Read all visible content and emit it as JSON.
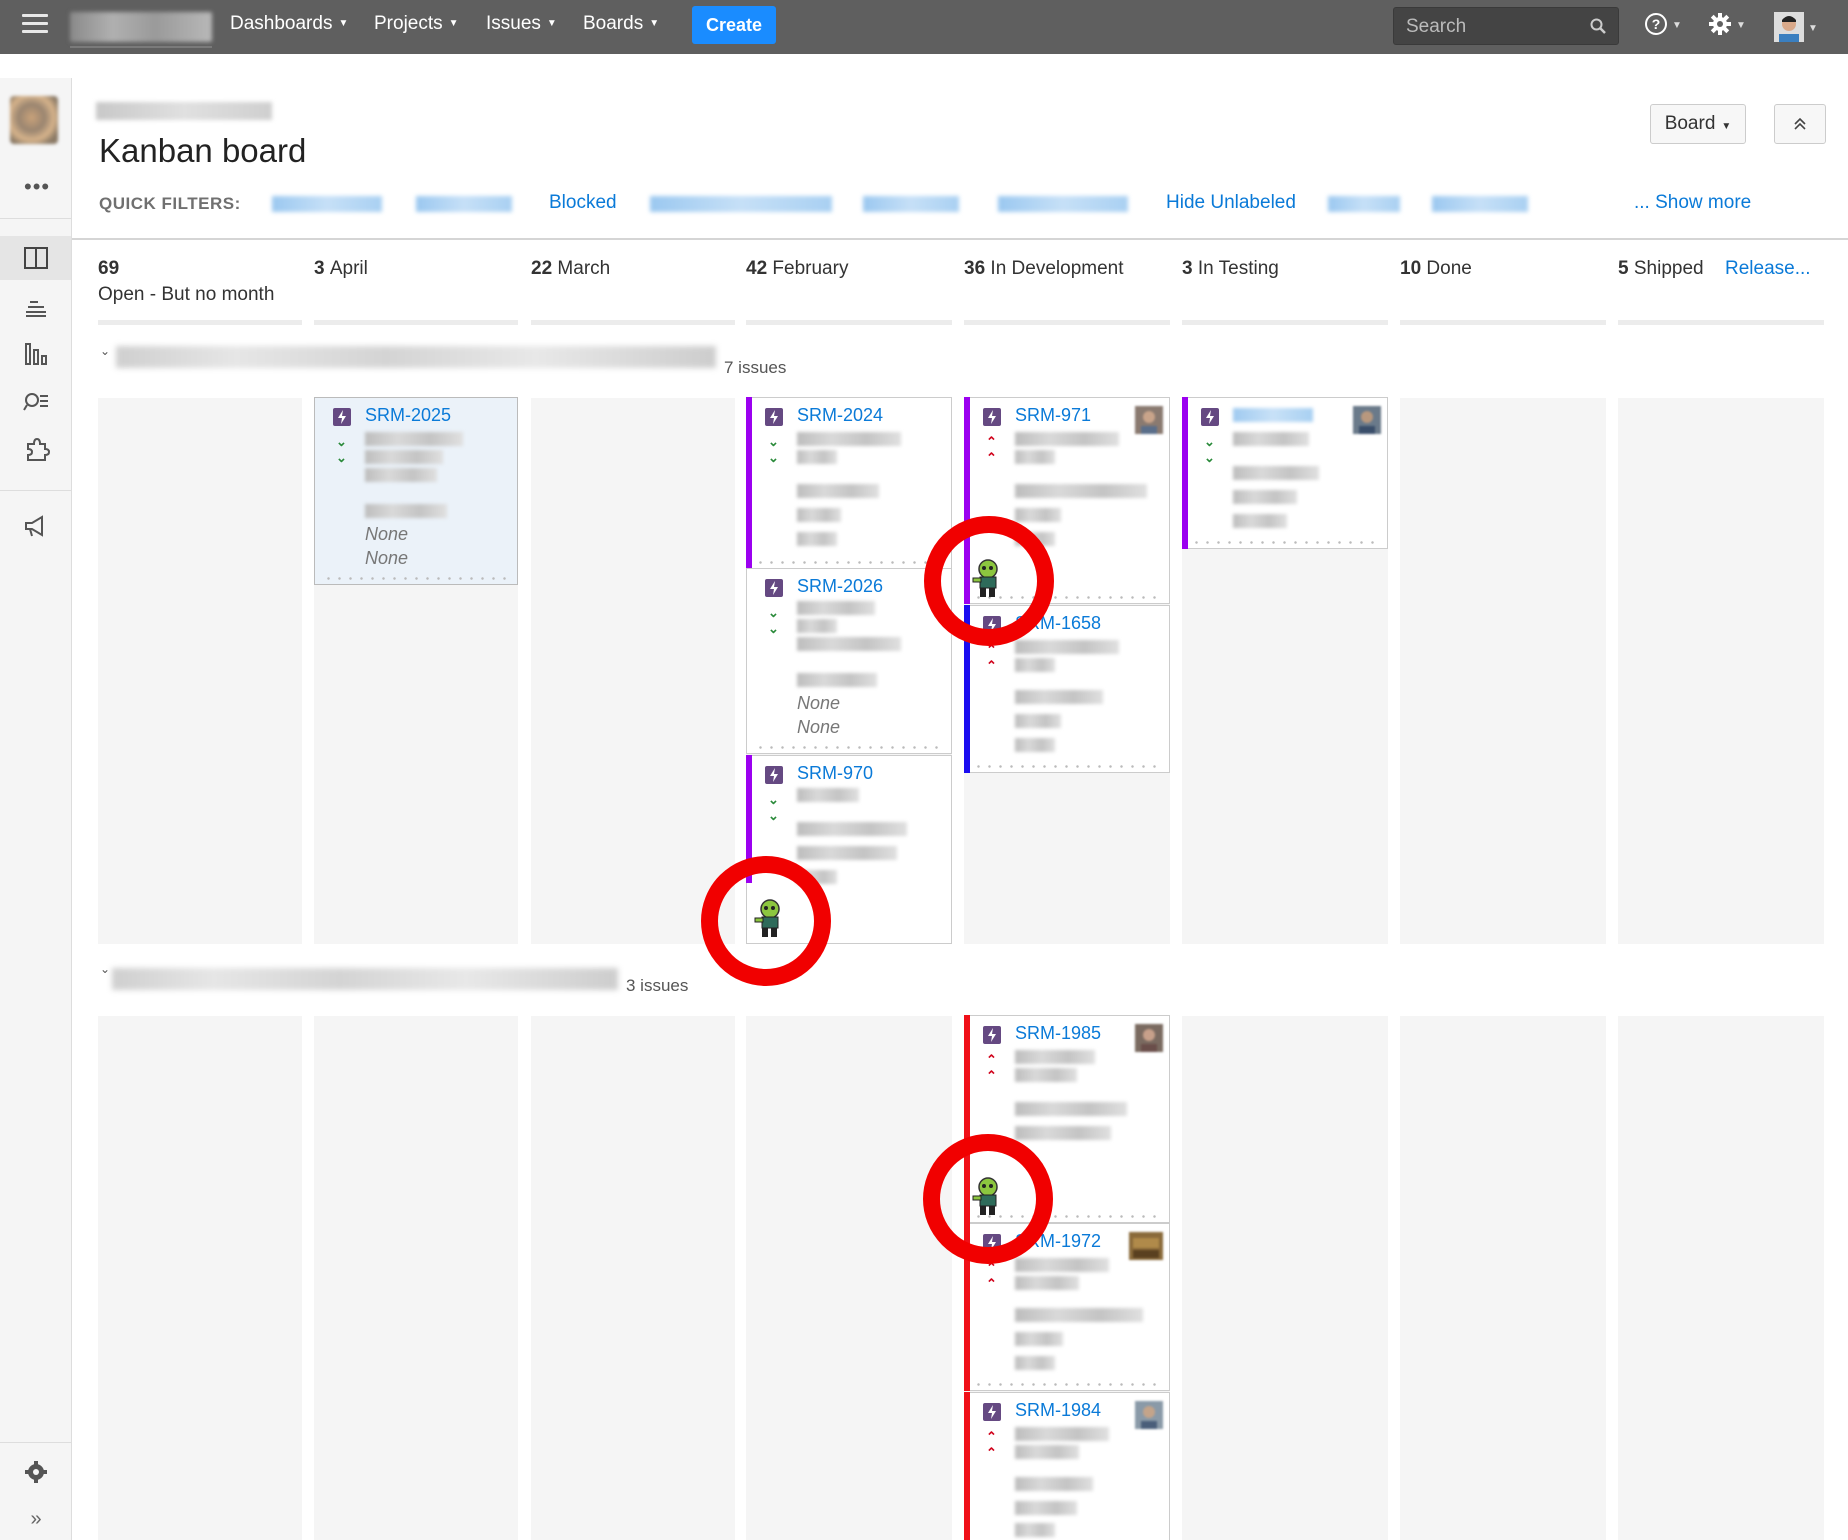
{
  "nav": {
    "menu_items": [
      "Dashboards",
      "Projects",
      "Issues",
      "Boards"
    ],
    "create_label": "Create",
    "search_placeholder": "Search"
  },
  "header": {
    "title": "Kanban board",
    "board_button": "Board"
  },
  "quick_filters": {
    "label": "QUICK FILTERS:",
    "visible_items": [
      "Blocked",
      "Hide Unlabeled"
    ],
    "show_more": "... Show more"
  },
  "columns": [
    {
      "count": "69",
      "name": "Open - But no month"
    },
    {
      "count": "3",
      "name": "April"
    },
    {
      "count": "22",
      "name": "March"
    },
    {
      "count": "42",
      "name": "February"
    },
    {
      "count": "36",
      "name": "In Development"
    },
    {
      "count": "3",
      "name": "In Testing"
    },
    {
      "count": "10",
      "name": "Done"
    },
    {
      "count": "5",
      "name": "Shipped"
    }
  ],
  "release_link": "Release...",
  "swimlanes": [
    {
      "count_label": "7 issues"
    },
    {
      "count_label": "3 issues"
    }
  ],
  "cards": [
    {
      "key": "SRM-2025",
      "priority": "low",
      "none1": "None",
      "none2": "None"
    },
    {
      "key": "SRM-2024",
      "priority": "low"
    },
    {
      "key": "SRM-2026",
      "priority": "low",
      "none1": "None",
      "none2": "None"
    },
    {
      "key": "SRM-970",
      "priority": "low"
    },
    {
      "key": "SRM-971",
      "priority": "high"
    },
    {
      "key": "SRM-1658",
      "priority": "high"
    },
    {
      "key": "",
      "priority": "low"
    },
    {
      "key": "SRM-1985",
      "priority": "high"
    },
    {
      "key": "SRM-1972",
      "priority": "high"
    },
    {
      "key": "SRM-1984",
      "priority": "high"
    }
  ],
  "colors": {
    "topnav": "#5f5f5f",
    "create": "#1a8cff",
    "link": "#0a7ad8",
    "epic_purple": "#9b00f0",
    "epic_blue": "#1a0cf0",
    "epic_red": "#f01018",
    "marker_red": "#f10000"
  },
  "icons": [
    "menu-icon",
    "search-icon",
    "help-icon",
    "gear-icon",
    "user-avatar",
    "board-icon",
    "backlog-icon",
    "reports-icon",
    "issues-icon",
    "addons-icon",
    "announce-icon",
    "settings-icon",
    "expand-icon",
    "story-icon",
    "priority-low-icon",
    "priority-high-icon",
    "zombie-icon"
  ]
}
